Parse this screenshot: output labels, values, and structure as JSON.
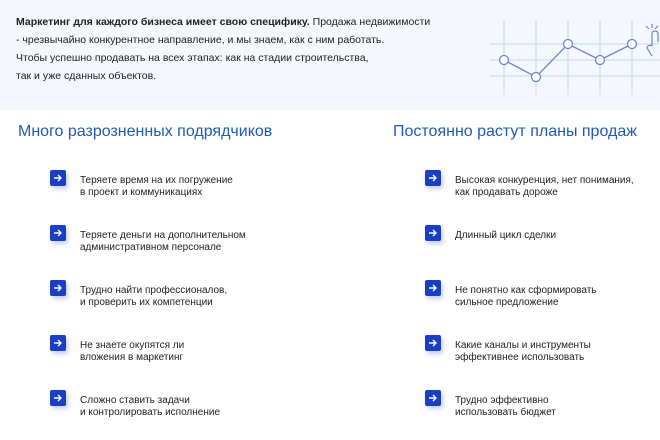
{
  "intro": {
    "bold_lead": "Маркетинг для каждого бизнеса имеет свою специфику.",
    "line1_rest": " Продажа недвижимости",
    "line2": "- чрезвычайно конкурентное направление, и мы знаем, как с ним работать.",
    "line3": "Чтобы успешно продавать на всех этапах: как на стадии строительства,",
    "line4": "так и уже сданных объектов."
  },
  "left_column": {
    "title": "Много разрозненных подрядчиков",
    "items": [
      {
        "line1": "Теряете время на их погружение",
        "line2": "в проект и коммуникациях"
      },
      {
        "line1": "Теряете деньги на дополнительном",
        "line2": "административном персонале"
      },
      {
        "line1": "Трудно найти профессионалов,",
        "line2": "и проверить их компетенции"
      },
      {
        "line1": "Не знаете окупятся ли",
        "line2": "вложения в маркетинг"
      },
      {
        "line1": "Сложно ставить задачи",
        "line2": "и контролировать исполнение"
      }
    ]
  },
  "right_column": {
    "title": "Постоянно растут планы продаж",
    "items": [
      {
        "line1": "Высокая конкуренция, нет понимания,",
        "line2": "как продавать дороже"
      },
      {
        "line1": "Длинный цикл сделки",
        "line2": ""
      },
      {
        "line1": "Не понятно как сформировать",
        "line2": "сильное предложение"
      },
      {
        "line1": "Какие каналы и инструменты",
        "line2": "эффективнее использовать"
      },
      {
        "line1": "Трудно эффективно",
        "line2": "использовать бюджет"
      }
    ]
  },
  "icons": {
    "list_marker": "arrow-right-icon",
    "decoration": "line-graph-icon",
    "cursor": "hand-pointer-icon"
  },
  "colors": {
    "accent": "#1a3fc4",
    "title": "#1f5bb8",
    "band": "#f4f7fb"
  }
}
